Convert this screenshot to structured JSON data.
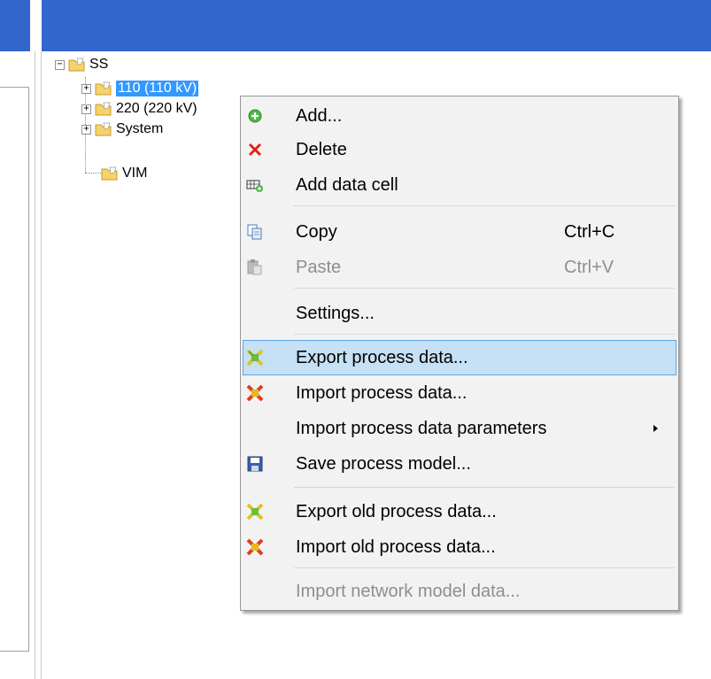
{
  "tree": {
    "root": "SS",
    "children": [
      {
        "label": "110 (110 kV)",
        "selected": true
      },
      {
        "label": "220 (220 kV)"
      },
      {
        "label": "System"
      },
      {
        "label": "VIM"
      }
    ]
  },
  "menu": {
    "items": [
      {
        "label": "Add...",
        "icon": "add-icon"
      },
      {
        "label": "Delete",
        "icon": "delete-icon"
      },
      {
        "label": "Add data cell",
        "icon": "add-data-cell-icon"
      },
      {
        "label": "Copy",
        "shortcut": "Ctrl+C",
        "icon": "copy-icon"
      },
      {
        "label": "Paste",
        "shortcut": "Ctrl+V",
        "icon": "paste-icon",
        "disabled": true
      },
      {
        "label": "Settings..."
      },
      {
        "label": "Export process data...",
        "icon": "export-icon",
        "highlighted": true
      },
      {
        "label": "Import process data...",
        "icon": "import-icon"
      },
      {
        "label": "Import process data parameters",
        "submenu": true
      },
      {
        "label": "Save process model...",
        "icon": "save-icon"
      },
      {
        "label": "Export old process data...",
        "icon": "export-icon"
      },
      {
        "label": "Import old process data...",
        "icon": "import-icon"
      },
      {
        "label": "Import network model data...",
        "disabled": true
      }
    ]
  },
  "colors": {
    "header": "#3366cc",
    "selection": "#3399ff",
    "menu_highlight": "#c6e0f5",
    "menu_highlight_border": "#5ba7e6"
  }
}
